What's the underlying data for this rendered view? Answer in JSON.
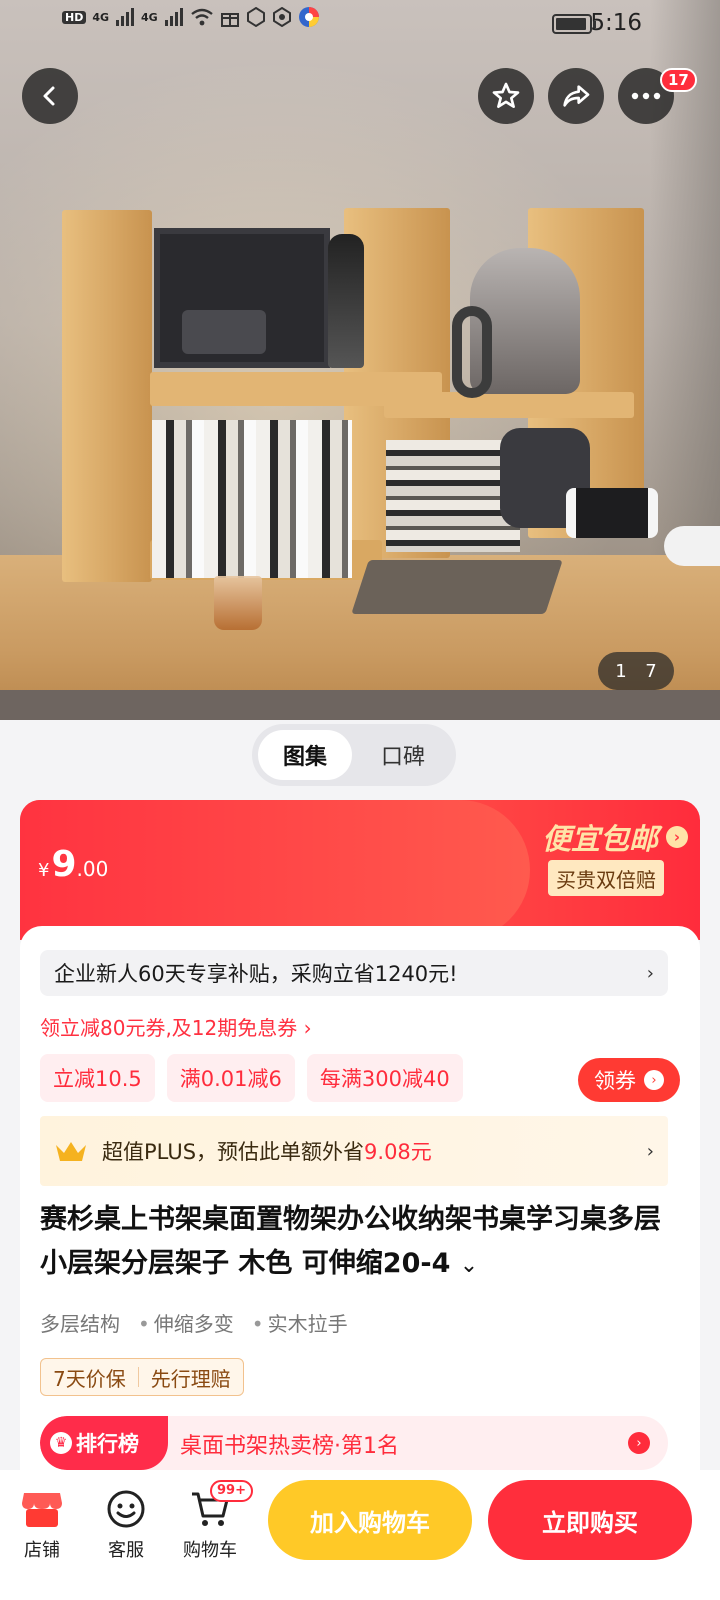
{
  "status_bar": {
    "hd1": "HD",
    "hd2": "HD",
    "signal1": "4G",
    "signal2": "4G",
    "time": "5:16"
  },
  "gallery": {
    "current": "1",
    "total": "7",
    "more_badge": "17"
  },
  "tabs": [
    {
      "label": "图集"
    },
    {
      "label": "口碑"
    }
  ],
  "price": {
    "currency": "¥",
    "integer": "9",
    "decimal": ".00",
    "promo_title": "便宜包邮",
    "promo_badge": "买贵双倍赔"
  },
  "offers": {
    "subsidy_text": "企业新人60天专享补贴，采购立省1240元!",
    "coupon_link": "领立减80元券,及12期免息券 ›",
    "tags": [
      "立减10.5",
      "满0.01减6",
      "每满300减40"
    ],
    "get_coupon": "领券",
    "plus_prefix": "超值PLUS，预估此单额外省",
    "plus_amount": "9.08元"
  },
  "product": {
    "title": "赛杉桌上书架桌面置物架办公收纳架书桌学习桌多层小层架分层架子 木色 可伸缩20-4",
    "features": [
      "多层结构",
      "伸缩多变",
      "实木拉手"
    ],
    "guarantees": [
      "7天价保",
      "先行理赔"
    ],
    "rank_label": "排行榜",
    "rank_text": "桌面书架热卖榜·第1名"
  },
  "bottom_bar": {
    "store": "店铺",
    "service": "客服",
    "cart": "购物车",
    "cart_badge": "99+",
    "add_to_cart": "加入购物车",
    "buy_now": "立即购买"
  },
  "colors": {
    "accent_red": "#ff2e3c",
    "accent_yellow": "#ffc927",
    "promo_gold": "#ffe3a8"
  }
}
